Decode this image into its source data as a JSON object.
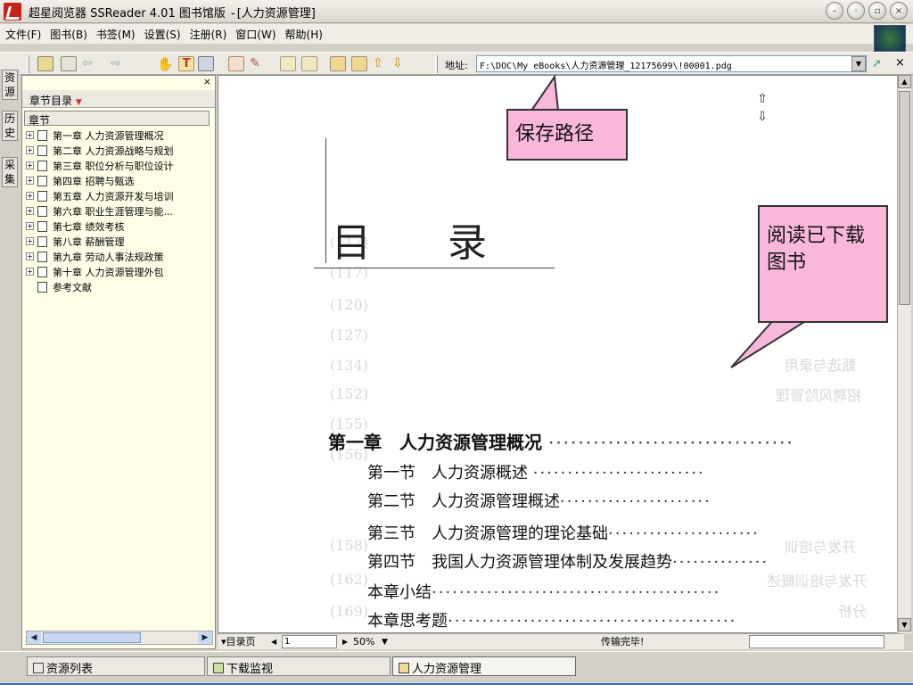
{
  "window": {
    "app_name": "超星阅览器 SSReader 4.01 图书馆版",
    "separator": "-",
    "doc_title": "[人力资源管理]",
    "buttons": [
      "minimize",
      "restore",
      "maximize",
      "close"
    ]
  },
  "menu": [
    "文件(F)",
    "图书(B)",
    "书签(M)",
    "设置(S)",
    "注册(R)",
    "窗口(W)",
    "帮助(H)"
  ],
  "toolbar": {
    "address_label": "地址:",
    "address_value": "F:\\DOC\\My eBooks\\人力资源管理_12175699\\!00001.pdg"
  },
  "side_tabs": [
    "资源",
    "历史",
    "采集"
  ],
  "left_panel": {
    "close_glyph": "×",
    "header": "章节目录",
    "column_header": "章节",
    "chapters": [
      "第一章 人力资源管理概况",
      "第二章 人力资源战略与规划",
      "第三章 职位分析与职位设计",
      "第四章 招聘与甄选",
      "第五章 人力资源开发与培训",
      "第六章 职业生涯管理与能...",
      "第七章 绩效考核",
      "第八章 薪酬管理",
      "第九章 劳动人事法规政策",
      "第十章 人力资源管理外包",
      "参考文献"
    ]
  },
  "document": {
    "title": "目 录",
    "chapter": "第一章　人力资源管理概况",
    "sections": [
      "第一节　人力资源概述",
      "第二节　人力资源管理概述",
      "第三节　人力资源管理的理论基础",
      "第四节　我国人力资源管理体制及发展趋势",
      "本章小结",
      "本章思考题"
    ],
    "faint_numbers": [
      "(117)",
      "(120)",
      "(127)",
      "(134)",
      "(152)",
      "(155)",
      "(156)",
      "(158)",
      "(162)",
      "(169)"
    ],
    "faint_right": [
      "甄选与录用",
      "招聘风险管理",
      "开发与培训",
      "开发与培训概述",
      "分析"
    ]
  },
  "callouts": {
    "save_path": "保存路径",
    "read_downloaded": "阅读已下载图书"
  },
  "statusbar": {
    "toc_page": "▾目录页",
    "page_value": "1",
    "zoom": "50%",
    "status": "传输完毕!"
  },
  "taskbar": {
    "items": [
      "资源列表",
      "下载监视",
      "人力资源管理"
    ]
  }
}
